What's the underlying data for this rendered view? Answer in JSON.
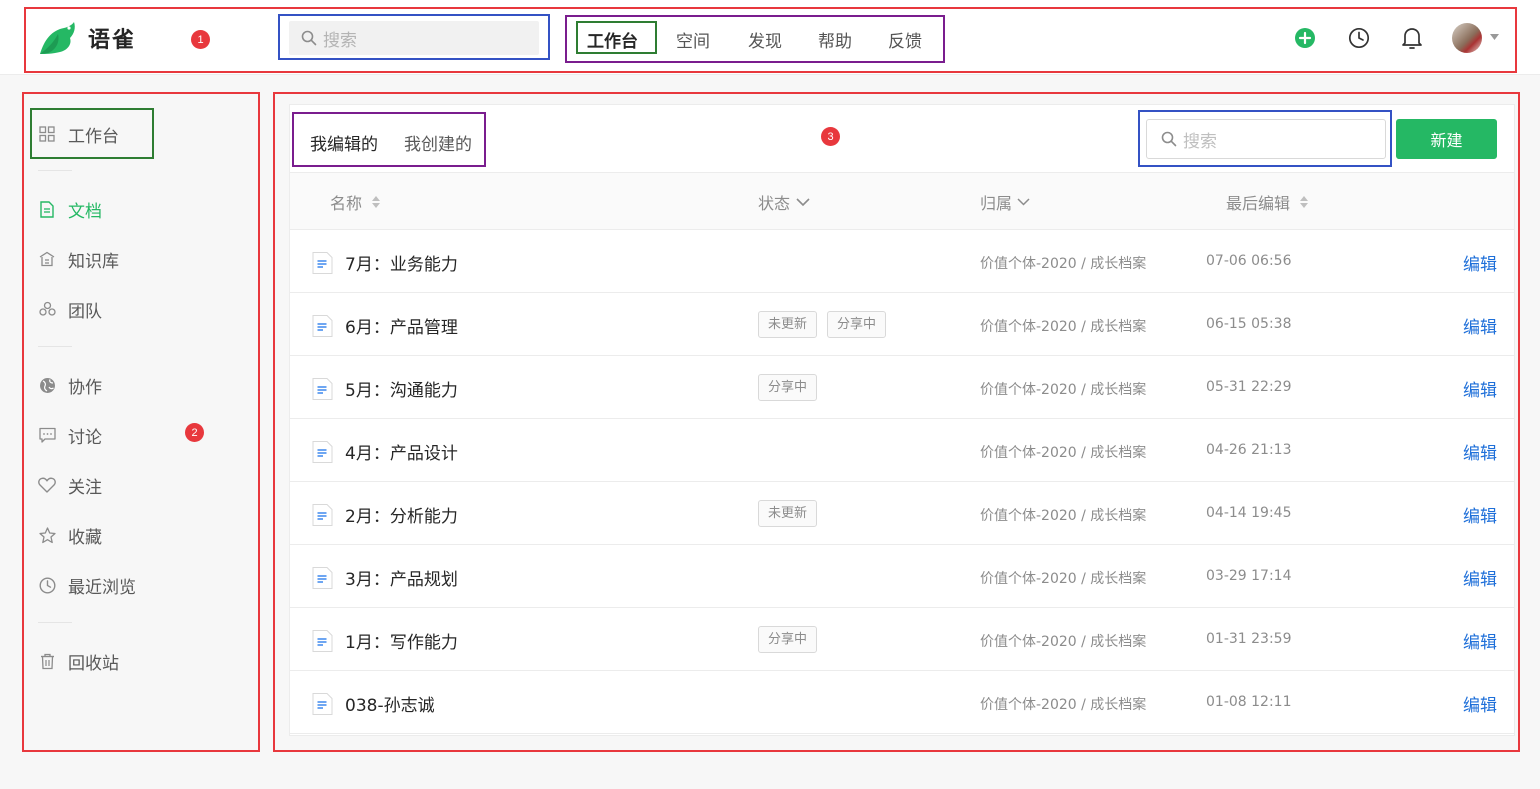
{
  "header": {
    "logo_text": "语雀",
    "badge": "1",
    "search_placeholder": "搜索",
    "nav": [
      {
        "label": "工作台",
        "active": true
      },
      {
        "label": "空间"
      },
      {
        "label": "发现"
      },
      {
        "label": "帮助"
      },
      {
        "label": "反馈"
      }
    ],
    "icons": [
      "plus-circle-icon",
      "clock-icon",
      "bell-icon",
      "avatar",
      "caret-down-icon"
    ]
  },
  "sidebar": {
    "badge": "2",
    "items": [
      {
        "label": "工作台",
        "icon": "grid-icon"
      },
      {
        "label": "文档",
        "icon": "document-icon",
        "active": true
      },
      {
        "label": "知识库",
        "icon": "library-icon"
      },
      {
        "label": "团队",
        "icon": "team-icon"
      },
      {
        "label": "协作",
        "icon": "globe-icon"
      },
      {
        "label": "讨论",
        "icon": "chat-icon"
      },
      {
        "label": "关注",
        "icon": "heart-icon"
      },
      {
        "label": "收藏",
        "icon": "star-icon"
      },
      {
        "label": "最近浏览",
        "icon": "clock-icon"
      },
      {
        "label": "回收站",
        "icon": "trash-icon"
      }
    ]
  },
  "main": {
    "badge": "3",
    "tabs": [
      {
        "label": "我编辑的",
        "active": true
      },
      {
        "label": "我创建的"
      }
    ],
    "search_placeholder": "搜索",
    "new_button": "新建",
    "columns": {
      "name": "名称",
      "status": "状态",
      "belong": "归属",
      "last_edit": "最后编辑"
    },
    "edit_label": "编辑",
    "rows": [
      {
        "title": "7月：业务能力",
        "tags": [],
        "belong": "价值个体-2020 / 成长档案",
        "time": "07-06 06:56"
      },
      {
        "title": "6月：产品管理",
        "tags": [
          "未更新",
          "分享中"
        ],
        "belong": "价值个体-2020 / 成长档案",
        "time": "06-15 05:38"
      },
      {
        "title": "5月：沟通能力",
        "tags": [
          "分享中"
        ],
        "belong": "价值个体-2020 / 成长档案",
        "time": "05-31 22:29"
      },
      {
        "title": "4月：产品设计",
        "tags": [],
        "belong": "价值个体-2020 / 成长档案",
        "time": "04-26 21:13"
      },
      {
        "title": "2月：分析能力",
        "tags": [
          "未更新"
        ],
        "belong": "价值个体-2020 / 成长档案",
        "time": "04-14 19:45"
      },
      {
        "title": "3月：产品规划",
        "tags": [],
        "belong": "价值个体-2020 / 成长档案",
        "time": "03-29 17:14"
      },
      {
        "title": "1月：写作能力",
        "tags": [
          "分享中"
        ],
        "belong": "价值个体-2020 / 成长档案",
        "time": "01-31 23:59"
      },
      {
        "title": "038-孙志诚",
        "tags": [],
        "belong": "价值个体-2020 / 成长档案",
        "time": "01-08 12:11"
      }
    ]
  },
  "colors": {
    "brand_green": "#25b864",
    "link_blue": "#1e6fd9",
    "annotation_red": "#e8383d"
  }
}
